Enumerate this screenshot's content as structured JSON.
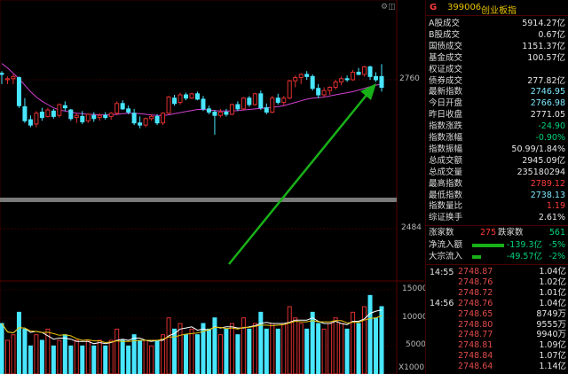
{
  "header": {
    "badge": "G",
    "code": "399006",
    "name": "创业板指"
  },
  "axis": {
    "price_high": "2760",
    "price_low": "2484",
    "vol_15000": "15000",
    "vol_10000": "10000",
    "vol_5000": "5000",
    "vol_unit": "X1000"
  },
  "stats": [
    {
      "label": "A股成交",
      "value": "5914.27亿",
      "color": "white"
    },
    {
      "label": "B股成交",
      "value": "0.67亿",
      "color": "white"
    },
    {
      "label": "国债成交",
      "value": "1151.37亿",
      "color": "white"
    },
    {
      "label": "基金成交",
      "value": "100.57亿",
      "color": "white"
    },
    {
      "label": "权证成交",
      "value": "",
      "color": "white"
    },
    {
      "label": "债券成交",
      "value": "277.82亿",
      "color": "white"
    },
    {
      "label": "最新指数",
      "value": "2746.95",
      "color": "cyan"
    },
    {
      "label": "今日开盘",
      "value": "2766.98",
      "color": "cyan"
    },
    {
      "label": "昨日收盘",
      "value": "2771.05",
      "color": "white"
    },
    {
      "label": "指数涨跌",
      "value": "-24.90",
      "color": "green"
    },
    {
      "label": "指数涨幅",
      "value": "-0.90%",
      "color": "green"
    },
    {
      "label": "指数振幅",
      "value": "50.99/1.84%",
      "color": "white"
    },
    {
      "label": "总成交额",
      "value": "2945.09亿",
      "color": "white"
    },
    {
      "label": "总成交量",
      "value": "235180294",
      "color": "white"
    },
    {
      "label": "最高指数",
      "value": "2789.12",
      "color": "red"
    },
    {
      "label": "最低指数",
      "value": "2738.13",
      "color": "cyan"
    },
    {
      "label": "指数量比",
      "value": "1.19",
      "color": "red"
    },
    {
      "label": "综证换手",
      "value": "2.61%",
      "color": "white"
    }
  ],
  "breadth": {
    "up_label": "涨家数",
    "up_value": "275",
    "down_label": "跌家数",
    "down_value": "561"
  },
  "flows": [
    {
      "label": "净流入额",
      "value": "-139.3亿",
      "pct": "-5%",
      "fill": 0.45
    },
    {
      "label": "大宗流入",
      "value": "-49.57亿",
      "pct": "-2%",
      "fill": 0.12
    }
  ],
  "ticks": {
    "time1": "14:55",
    "time2": "14:56",
    "rows": [
      {
        "price": "2748.87",
        "vol": "1.04亿"
      },
      {
        "price": "2748.76",
        "vol": "1.02亿"
      },
      {
        "price": "2748.72",
        "vol": "1.01亿"
      },
      {
        "price": "2748.76",
        "vol": "1.04亿"
      },
      {
        "price": "2748.65",
        "vol": "8749万"
      },
      {
        "price": "2748.80",
        "vol": "9555万"
      },
      {
        "price": "2748.77",
        "vol": "9940万"
      },
      {
        "price": "2748.81",
        "vol": "1.09亿"
      },
      {
        "price": "2748.84",
        "vol": "1.07亿"
      },
      {
        "price": "2748.64",
        "vol": "1.14亿"
      }
    ]
  },
  "colors": {
    "up": "#e03030",
    "down": "#48e6ff",
    "ma": "#d040d0",
    "arrow": "#18b018",
    "bg": "#000000"
  },
  "chart_data": {
    "type": "candlestick",
    "candles": [
      {
        "o": 2772,
        "h": 2776,
        "l": 2752,
        "c": 2770
      },
      {
        "o": 2760,
        "h": 2766,
        "l": 2752,
        "c": 2762
      },
      {
        "o": 2762,
        "h": 2770,
        "l": 2752,
        "c": 2766
      },
      {
        "o": 2764,
        "h": 2766,
        "l": 2708,
        "c": 2712
      },
      {
        "o": 2710,
        "h": 2726,
        "l": 2680,
        "c": 2684
      },
      {
        "o": 2686,
        "h": 2694,
        "l": 2672,
        "c": 2676
      },
      {
        "o": 2678,
        "h": 2702,
        "l": 2672,
        "c": 2698
      },
      {
        "o": 2700,
        "h": 2708,
        "l": 2684,
        "c": 2690
      },
      {
        "o": 2692,
        "h": 2708,
        "l": 2690,
        "c": 2704
      },
      {
        "o": 2702,
        "h": 2706,
        "l": 2688,
        "c": 2692
      },
      {
        "o": 2694,
        "h": 2716,
        "l": 2690,
        "c": 2714
      },
      {
        "o": 2712,
        "h": 2720,
        "l": 2702,
        "c": 2708
      },
      {
        "o": 2704,
        "h": 2706,
        "l": 2684,
        "c": 2688
      },
      {
        "o": 2690,
        "h": 2698,
        "l": 2680,
        "c": 2694
      },
      {
        "o": 2692,
        "h": 2702,
        "l": 2678,
        "c": 2682
      },
      {
        "o": 2684,
        "h": 2698,
        "l": 2680,
        "c": 2696
      },
      {
        "o": 2694,
        "h": 2700,
        "l": 2682,
        "c": 2688
      },
      {
        "o": 2690,
        "h": 2698,
        "l": 2684,
        "c": 2694
      },
      {
        "o": 2694,
        "h": 2700,
        "l": 2686,
        "c": 2690
      },
      {
        "o": 2692,
        "h": 2700,
        "l": 2686,
        "c": 2698
      },
      {
        "o": 2698,
        "h": 2720,
        "l": 2694,
        "c": 2716
      },
      {
        "o": 2716,
        "h": 2722,
        "l": 2704,
        "c": 2706
      },
      {
        "o": 2706,
        "h": 2712,
        "l": 2696,
        "c": 2700
      },
      {
        "o": 2698,
        "h": 2706,
        "l": 2676,
        "c": 2680
      },
      {
        "o": 2680,
        "h": 2692,
        "l": 2670,
        "c": 2676
      },
      {
        "o": 2676,
        "h": 2690,
        "l": 2672,
        "c": 2688
      },
      {
        "o": 2688,
        "h": 2696,
        "l": 2684,
        "c": 2692
      },
      {
        "o": 2692,
        "h": 2696,
        "l": 2676,
        "c": 2680
      },
      {
        "o": 2680,
        "h": 2700,
        "l": 2676,
        "c": 2698
      },
      {
        "o": 2698,
        "h": 2730,
        "l": 2696,
        "c": 2728
      },
      {
        "o": 2726,
        "h": 2732,
        "l": 2712,
        "c": 2716
      },
      {
        "o": 2718,
        "h": 2736,
        "l": 2714,
        "c": 2732
      },
      {
        "o": 2732,
        "h": 2736,
        "l": 2722,
        "c": 2726
      },
      {
        "o": 2726,
        "h": 2736,
        "l": 2724,
        "c": 2734
      },
      {
        "o": 2734,
        "h": 2738,
        "l": 2722,
        "c": 2724
      },
      {
        "o": 2724,
        "h": 2730,
        "l": 2702,
        "c": 2706
      },
      {
        "o": 2706,
        "h": 2712,
        "l": 2696,
        "c": 2700
      },
      {
        "o": 2700,
        "h": 2704,
        "l": 2658,
        "c": 2694
      },
      {
        "o": 2694,
        "h": 2706,
        "l": 2690,
        "c": 2700
      },
      {
        "o": 2700,
        "h": 2706,
        "l": 2692,
        "c": 2696
      },
      {
        "o": 2696,
        "h": 2716,
        "l": 2694,
        "c": 2714
      },
      {
        "o": 2714,
        "h": 2720,
        "l": 2702,
        "c": 2706
      },
      {
        "o": 2706,
        "h": 2728,
        "l": 2704,
        "c": 2726
      },
      {
        "o": 2726,
        "h": 2730,
        "l": 2710,
        "c": 2714
      },
      {
        "o": 2714,
        "h": 2736,
        "l": 2712,
        "c": 2734
      },
      {
        "o": 2734,
        "h": 2740,
        "l": 2704,
        "c": 2708
      },
      {
        "o": 2708,
        "h": 2716,
        "l": 2696,
        "c": 2700
      },
      {
        "o": 2700,
        "h": 2730,
        "l": 2698,
        "c": 2726
      },
      {
        "o": 2726,
        "h": 2734,
        "l": 2714,
        "c": 2718
      },
      {
        "o": 2718,
        "h": 2730,
        "l": 2712,
        "c": 2726
      },
      {
        "o": 2726,
        "h": 2760,
        "l": 2724,
        "c": 2758
      },
      {
        "o": 2758,
        "h": 2768,
        "l": 2746,
        "c": 2764
      },
      {
        "o": 2764,
        "h": 2772,
        "l": 2752,
        "c": 2770
      },
      {
        "o": 2770,
        "h": 2776,
        "l": 2760,
        "c": 2766
      },
      {
        "o": 2766,
        "h": 2770,
        "l": 2740,
        "c": 2744
      },
      {
        "o": 2744,
        "h": 2752,
        "l": 2726,
        "c": 2732
      },
      {
        "o": 2732,
        "h": 2746,
        "l": 2728,
        "c": 2740
      },
      {
        "o": 2740,
        "h": 2748,
        "l": 2732,
        "c": 2746
      },
      {
        "o": 2746,
        "h": 2760,
        "l": 2742,
        "c": 2756
      },
      {
        "o": 2756,
        "h": 2766,
        "l": 2750,
        "c": 2762
      },
      {
        "o": 2762,
        "h": 2768,
        "l": 2756,
        "c": 2760
      },
      {
        "o": 2760,
        "h": 2778,
        "l": 2758,
        "c": 2774
      },
      {
        "o": 2774,
        "h": 2782,
        "l": 2768,
        "c": 2770
      },
      {
        "o": 2770,
        "h": 2786,
        "l": 2766,
        "c": 2784
      },
      {
        "o": 2784,
        "h": 2786,
        "l": 2760,
        "c": 2766
      },
      {
        "o": 2766,
        "h": 2774,
        "l": 2756,
        "c": 2760
      },
      {
        "o": 2766,
        "h": 2789,
        "l": 2738,
        "c": 2746
      }
    ],
    "volumes": [
      9,
      6,
      7,
      11,
      8,
      5,
      7,
      6,
      8,
      5,
      6,
      7,
      5,
      6,
      5,
      6,
      5,
      6,
      5,
      6,
      8,
      6,
      5,
      7,
      6,
      6,
      5,
      6,
      7,
      10,
      8,
      9,
      7,
      8,
      7,
      9,
      8,
      10,
      7,
      8,
      9,
      7,
      10,
      8,
      9,
      11,
      8,
      9,
      8,
      9,
      12,
      10,
      9,
      8,
      11,
      9,
      8,
      9,
      10,
      9,
      8,
      11,
      9,
      12,
      14,
      10,
      12
    ],
    "ma": [
      2790,
      2782,
      2772,
      2762,
      2750,
      2738,
      2728,
      2720,
      2714,
      2708,
      2704,
      2702,
      2700,
      2698,
      2697,
      2696,
      2696,
      2695,
      2695,
      2695,
      2696,
      2697,
      2698,
      2698,
      2697,
      2696,
      2695,
      2694,
      2694,
      2695,
      2697,
      2699,
      2701,
      2703,
      2705,
      2705,
      2704,
      2703,
      2702,
      2702,
      2702,
      2703,
      2704,
      2705,
      2706,
      2707,
      2708,
      2709,
      2710,
      2712,
      2715,
      2718,
      2721,
      2724,
      2726,
      2727,
      2728,
      2730,
      2732,
      2734,
      2736,
      2738,
      2741,
      2744,
      2747,
      2750,
      2752
    ]
  }
}
